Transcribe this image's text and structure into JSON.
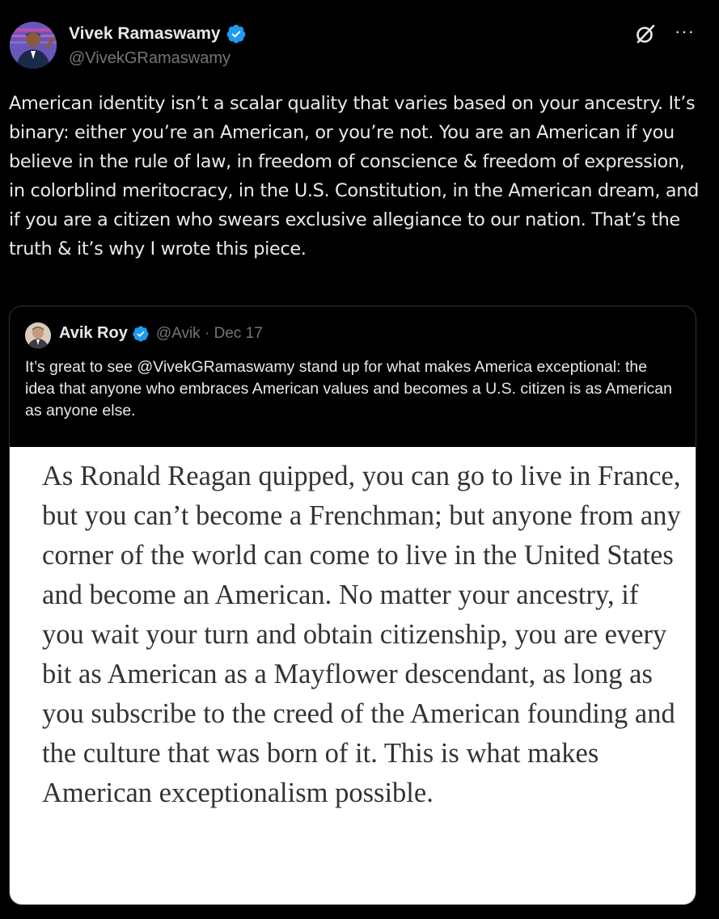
{
  "author": {
    "name": "Vivek Ramaswamy",
    "handle": "@VivekGRamaswamy",
    "verified": true
  },
  "icons": {
    "verified": "verified-badge-icon",
    "grok": "grok-icon",
    "more": "more-icon"
  },
  "more_glyph": "···",
  "tweet": {
    "text": "American identity isn’t a scalar quality that varies based on your ancestry. It’s binary: either you’re an American, or you’re not. You are an American if you believe in the rule of law, in freedom of conscience & freedom of expression, in colorblind meritocracy, in the U.S. Constitution, in the American dream, and if you are a citizen who swears exclusive allegiance to our nation. That’s the truth & it’s why I wrote this piece."
  },
  "quote": {
    "name": "Avik Roy",
    "handle": "@Avik",
    "separator": "·",
    "date": "Dec 17",
    "text": "It’s great to see @VivekGRamaswamy stand up for what makes America exceptional: the idea that anyone who embraces American values and becomes a U.S. citizen is as American as anyone else.",
    "image_text": "As Ronald Reagan quipped, you can go to live in France, but you can’t become a Frenchman; but anyone from any corner of the world can come to live in the United States and become an American. No matter your ancestry, if you wait your turn and obtain citizenship, you are every bit as American as a Mayflower descendant, as long as you subscribe to the creed of the American founding and the culture that was born of it. This is what makes American exceptionalism possible."
  },
  "colors": {
    "background": "#000000",
    "text": "#e7e9ea",
    "secondary": "#71767b",
    "verified": "#1d9bf0",
    "border": "#2f3336"
  }
}
